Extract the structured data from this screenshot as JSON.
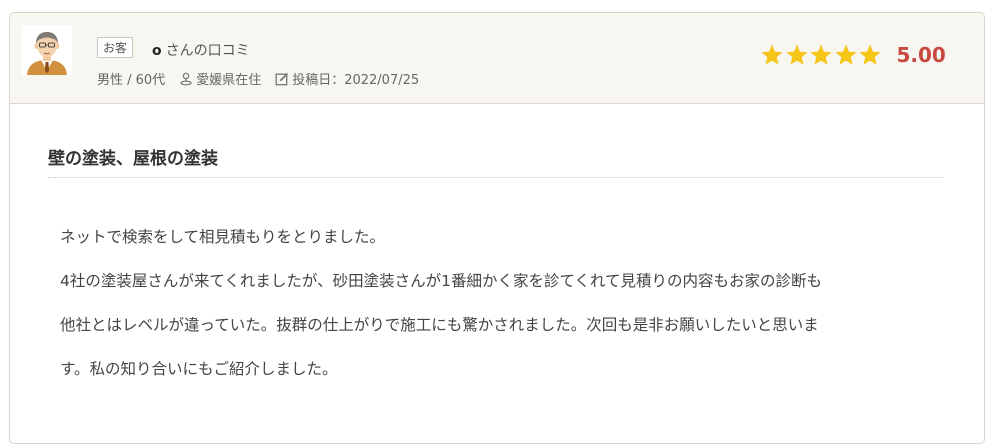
{
  "review": {
    "badge": "お客",
    "reviewer_name": "o",
    "reviewer_suffix": "さんの口コミ",
    "gender_age": "男性 / 60代",
    "location": "愛媛県在住",
    "posted": "投稿日：2022/07/25",
    "rating": "5.00",
    "stars": 5,
    "title": "壁の塗装、屋根の塗装",
    "body_lines": [
      "ネットで検索をして相見積もりをとりました。",
      "4社の塗装屋さんが来てくれましたが、砂田塗装さんが1番細かく家を診てくれて見積りの内容もお家の診断も",
      "他社とはレベルが違っていた。抜群の仕上がりで施工にも驚かされました。次回も是非お願いしたいと思いま",
      "す。私の知り合いにもご紹介しました。"
    ]
  },
  "colors": {
    "star": "#f5c518",
    "rating_value": "#c8473f",
    "header_bg": "#f7f6f1"
  },
  "icons": {
    "avatar": "elderly-man-avatar",
    "location": "map-pin-person-icon",
    "posted": "edit-note-icon",
    "star": "star-icon"
  }
}
